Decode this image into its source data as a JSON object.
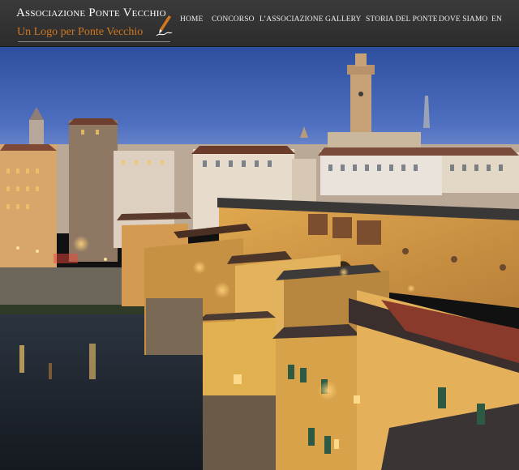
{
  "site": {
    "title": "Associazione Ponte Vecchio",
    "subtitle": "Un Logo per Ponte Vecchio"
  },
  "nav": {
    "items": [
      {
        "label": "HOME",
        "name": "nav-home"
      },
      {
        "label": "CONCORSO",
        "name": "nav-concorso"
      },
      {
        "label": "L’ASSOCIAZIONE",
        "name": "nav-associazione"
      },
      {
        "label": "GALLERY",
        "name": "nav-gallery"
      },
      {
        "label": "STORIA DEL PONTE",
        "name": "nav-storia-del-ponte"
      },
      {
        "label": "DOVE SIAMO",
        "name": "nav-dove-siamo"
      },
      {
        "label": "EN",
        "name": "nav-en"
      }
    ]
  },
  "hero": {
    "subject": "Ponte Vecchio at dusk photo"
  },
  "colors": {
    "header_bg": "#333333",
    "subtitle_accent": "#d1781e",
    "nav_text": "#ececec"
  }
}
